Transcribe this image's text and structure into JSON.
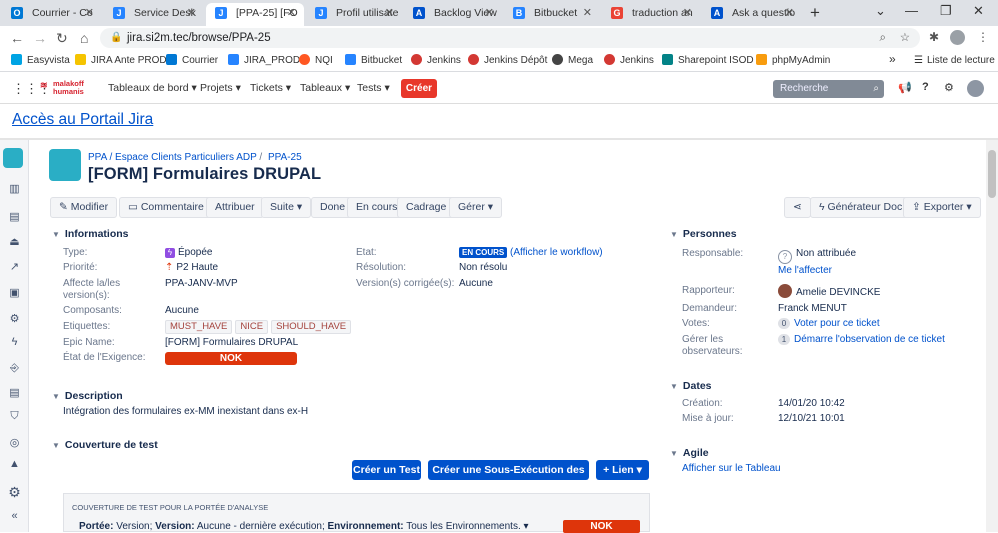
{
  "browser": {
    "tabs": [
      {
        "title": "Courrier - Co",
        "icon_color": "#0078d4",
        "icon_text": "O"
      },
      {
        "title": "Service Desk",
        "icon_color": "#2684ff",
        "icon_text": "J"
      },
      {
        "title": "[PPA-25] [FO",
        "icon_color": "#2684ff",
        "icon_text": "J"
      },
      {
        "title": "Profil utilisate",
        "icon_color": "#2684ff",
        "icon_text": "J"
      },
      {
        "title": "Backlog View",
        "icon_color": "#0052cc",
        "icon_text": "A"
      },
      {
        "title": "Bitbucket",
        "icon_color": "#2684ff",
        "icon_text": "B"
      },
      {
        "title": "traduction an",
        "icon_color": "#ea4335",
        "icon_text": "G"
      },
      {
        "title": "Ask a questio",
        "icon_color": "#0052cc",
        "icon_text": "A"
      }
    ],
    "new_tab": "+",
    "url": "jira.si2m.tec/browse/PPA-25",
    "bookmarks": [
      {
        "label": "Easyvista",
        "color": "#00a4e4"
      },
      {
        "label": "JIRA Ante PROD",
        "color": "#f5c400"
      },
      {
        "label": "Courrier",
        "color": "#0078d4"
      },
      {
        "label": "JIRA_PROD",
        "color": "#2684ff"
      },
      {
        "label": "NQI",
        "color": "#ff5722"
      },
      {
        "label": "Bitbucket",
        "color": "#2684ff"
      },
      {
        "label": "Jenkins",
        "color": "#d33833"
      },
      {
        "label": "Jenkins Dépôt",
        "color": "#d33833"
      },
      {
        "label": "Mega",
        "color": "#444444"
      },
      {
        "label": "Jenkins",
        "color": "#d33833"
      },
      {
        "label": "Sharepoint ISOD",
        "color": "#038387"
      },
      {
        "label": "phpMyAdmin",
        "color": "#f89c0e"
      }
    ],
    "more_bookmarks": "»",
    "reading_list": "Liste de lecture"
  },
  "jira": {
    "logo_line1": "malakoff",
    "logo_line2": "humanis",
    "menu": [
      "Tableaux de bord",
      "Projets",
      "Tickets",
      "Tableaux",
      "Tests"
    ],
    "create": "Créer",
    "search_placeholder": "Recherche",
    "portal_link": "Accès au Portail Jira"
  },
  "issue": {
    "project_path": "PPA / Espace Clients Particuliers ADP",
    "key": "PPA-25",
    "title": "[FORM] Formulaires DRUPAL",
    "toolbar": [
      "Modifier",
      "Commentaire",
      "Attribuer",
      "Suite",
      "Done",
      "En cours",
      "Cadrage",
      "Gérer"
    ],
    "toolbar_right": [
      "Générateur Doc",
      "Exporter"
    ],
    "informations": "Informations",
    "fields": {
      "type_label": "Type:",
      "type_value": "Épopée",
      "priorite_label": "Priorité:",
      "priorite_value": "P2 Haute",
      "affecte_label": "Affecte la/les version(s):",
      "affecte_value": "PPA-JANV-MVP",
      "composants_label": "Composants:",
      "composants_value": "Aucune",
      "etiquettes_label": "Etiquettes:",
      "etiquettes": [
        "MUST_HAVE",
        "NICE",
        "SHOULD_HAVE"
      ],
      "epic_label": "Epic Name:",
      "epic_value": "[FORM] Formulaires DRUPAL",
      "exigence_label": "État de l'Exigence:",
      "exigence_value": "NOK",
      "etat_label": "Etat:",
      "etat_badge": "EN COURS",
      "etat_link": "(Afficher le workflow)",
      "resolution_label": "Résolution:",
      "resolution_value": "Non résolu",
      "corrigee_label": "Version(s) corrigée(s):",
      "corrigee_value": "Aucune"
    },
    "description_title": "Description",
    "description_text": "Intégration des formulaires ex-MM inexistant dans ex-H",
    "couverture_title": "Couverture de test",
    "buttons": [
      "Créer un Test",
      "Créer une Sous-Exécution des Tests",
      "+ Lien"
    ],
    "couverture_box_title": "COUVERTURE DE TEST POUR LA PORTÉE D'ANALYSE",
    "couverture_line": {
      "portee_label": "Portée:",
      "portee_value": "Version;",
      "version_label": "Version:",
      "version_value": "Aucune - dernière exécution;",
      "env_label": "Environnement:",
      "env_value": "Tous les Environnements.",
      "status": "NOK"
    },
    "personnes_title": "Personnes",
    "personnes": {
      "resp_label": "Responsable:",
      "resp_value": "Non attribuée",
      "resp_link": "Me l'affecter",
      "rapp_label": "Rapporteur:",
      "rapp_value": "Amelie DEVINCKE",
      "dem_label": "Demandeur:",
      "dem_value": "Franck MENUT",
      "votes_label": "Votes:",
      "votes_count": "0",
      "votes_link": "Voter pour ce ticket",
      "obs_label": "Gérer les observateurs:",
      "obs_count": "1",
      "obs_link": "Démarre l'observation de ce ticket"
    },
    "dates_title": "Dates",
    "dates": {
      "creation_label": "Création:",
      "creation_value": "14/01/20 10:42",
      "maj_label": "Mise à jour:",
      "maj_value": "12/10/21 10:01"
    },
    "agile_title": "Agile",
    "agile_link": "Afficher sur le Tableau"
  }
}
